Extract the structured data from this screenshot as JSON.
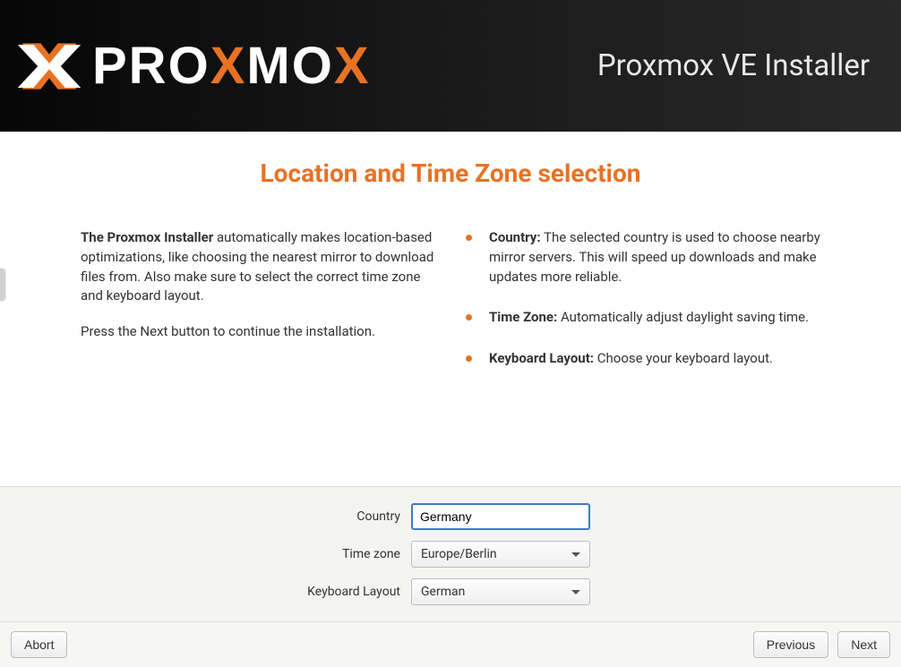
{
  "header": {
    "title": "Proxmox VE Installer",
    "logo_text_before_x1": "PRO",
    "logo_text_x1": "X",
    "logo_text_mid": "MO",
    "logo_text_x2": "X"
  },
  "page": {
    "heading": "Location and Time Zone selection",
    "left": {
      "lead_strong": "The Proxmox Installer",
      "lead_rest": " automatically makes location-based optimizations, like choosing the nearest mirror to download files from. Also make sure to select the correct time zone and keyboard layout.",
      "press_next": "Press the Next button to continue the installation."
    },
    "right": {
      "bullets": [
        {
          "title": "Country:",
          "text": " The selected country is used to choose nearby mirror servers. This will speed up downloads and make updates more reliable."
        },
        {
          "title": "Time Zone:",
          "text": " Automatically adjust daylight saving time."
        },
        {
          "title": "Keyboard Layout:",
          "text": " Choose your keyboard layout."
        }
      ]
    }
  },
  "form": {
    "country_label": "Country",
    "country_value": "Germany",
    "timezone_label": "Time zone",
    "timezone_value": "Europe/Berlin",
    "keyboard_label": "Keyboard Layout",
    "keyboard_value": "German"
  },
  "footer": {
    "abort": "Abort",
    "previous": "Previous",
    "next": "Next"
  }
}
